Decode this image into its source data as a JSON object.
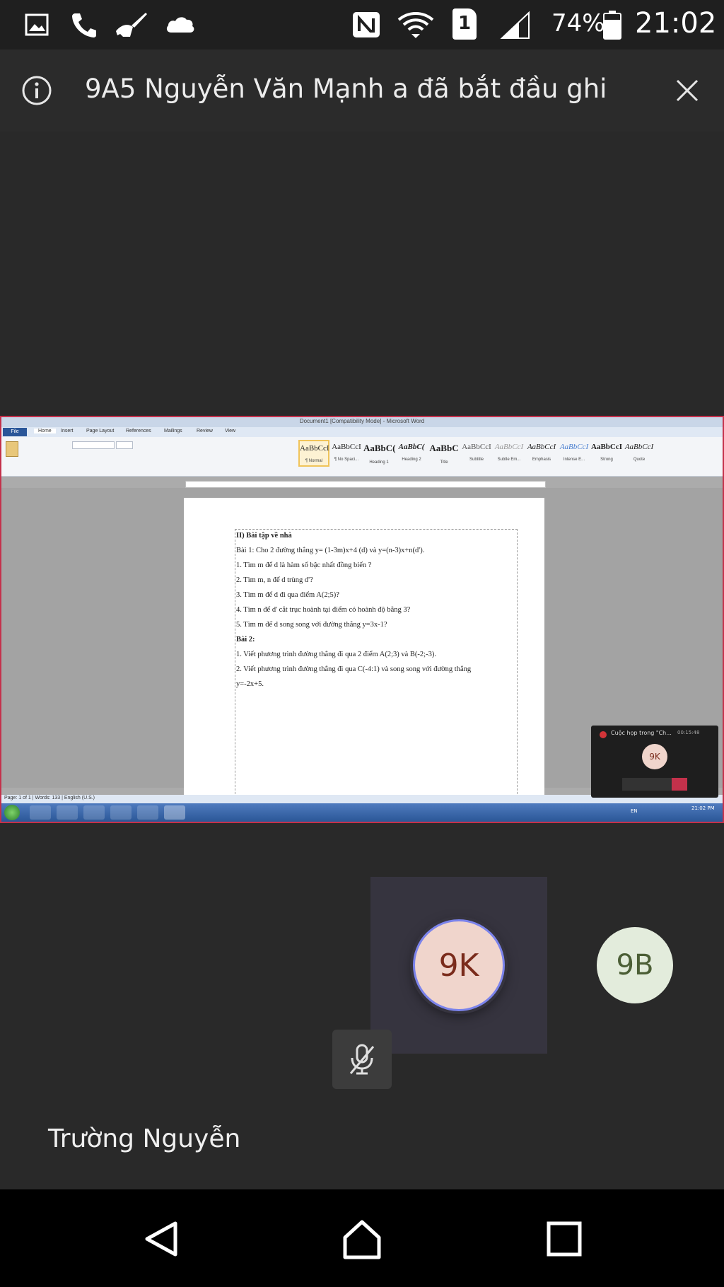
{
  "status_bar": {
    "battery_percent": "74%",
    "time": "21:02",
    "sim_slot": "1",
    "icons": [
      "gallery-icon",
      "phone-icon",
      "cleaner-icon",
      "cloud-icon",
      "nfc-icon",
      "wifi-icon",
      "sim-icon",
      "signal-icon",
      "battery-icon"
    ]
  },
  "banner": {
    "message": "9A5 Nguyễn Văn Mạnh a đã bắt đầu ghi",
    "info_icon": "info-icon",
    "close_icon": "close-icon"
  },
  "shared_screen": {
    "window_title": "Document1 [Compatibility Mode] - Microsoft Word",
    "tabs": [
      "File",
      "Home",
      "Insert",
      "Page Layout",
      "References",
      "Mailings",
      "Review",
      "View"
    ],
    "styles": [
      {
        "sample": "AaBbCcI",
        "name": "¶ Normal"
      },
      {
        "sample": "AaBbCcI",
        "name": "¶ No Spaci..."
      },
      {
        "sample": "AaBbC(",
        "name": "Heading 1"
      },
      {
        "sample": "AaBbC(",
        "name": "Heading 2"
      },
      {
        "sample": "AaBbC",
        "name": "Title"
      },
      {
        "sample": "AaBbCcI",
        "name": "Subtitle"
      },
      {
        "sample": "AaBbCcI",
        "name": "Subtle Em..."
      },
      {
        "sample": "AaBbCcI",
        "name": "Emphasis"
      },
      {
        "sample": "AaBbCcI",
        "name": "Intense E..."
      },
      {
        "sample": "AaBbCcI",
        "name": "Strong"
      },
      {
        "sample": "AaBbCcI",
        "name": "Quote"
      }
    ],
    "document_lines": [
      {
        "text": "II) Bài tập về nhà",
        "bold": true
      },
      {
        "text": "Bài 1: Cho 2 đường thẳng y= (1-3m)x+4 (d) và  y=(n-3)x+n(d').",
        "bold": false
      },
      {
        "text": "1. Tìm m để d là hàm số bậc nhất đồng biến ?",
        "bold": false
      },
      {
        "text": "2. Tìm m, n để d trùng d'?",
        "bold": false
      },
      {
        "text": "3. Tìm m để d đi qua điểm A(2;5)?",
        "bold": false
      },
      {
        "text": "4. Tìm n để d' cắt trục hoành tại điểm có hoành độ bằng 3?",
        "bold": false
      },
      {
        "text": "5. Tìm m để d song song với đường thẳng y=3x-1?",
        "bold": false
      },
      {
        "text": "Bài 2:",
        "bold": true
      },
      {
        "text": "1. Viết phương trình đường thẳng đi qua 2 điểm A(2;3) và B(-2;-3).",
        "bold": false
      },
      {
        "text": "2. Viết phương trình đường thẳng đi qua C(-4:1) và song song với đường thẳng",
        "bold": false
      },
      {
        "text": "y=-2x+5.",
        "bold": false
      }
    ],
    "status_text": "Page: 1 of 1 | Words: 133 | English (U.S.)",
    "mini_window": {
      "title": "Cuộc họp trong \"Ch...",
      "timer": "00:15:48",
      "avatar": "9K"
    },
    "taskbar_clock": "21:02 PM",
    "taskbar_lang": "EN"
  },
  "participants": [
    {
      "initials": "9K",
      "active": true,
      "bg": "#f0d5cc",
      "fg": "#7a2b1b"
    },
    {
      "initials": "9B",
      "active": false,
      "bg": "#e3ecdc",
      "fg": "#4b5e35"
    }
  ],
  "self_view": {
    "name": "Trường Nguyễn",
    "mic_icon": "mic-off-icon"
  },
  "colors": {
    "share_border": "#c4314b",
    "active_ring": "#7b83eb"
  }
}
